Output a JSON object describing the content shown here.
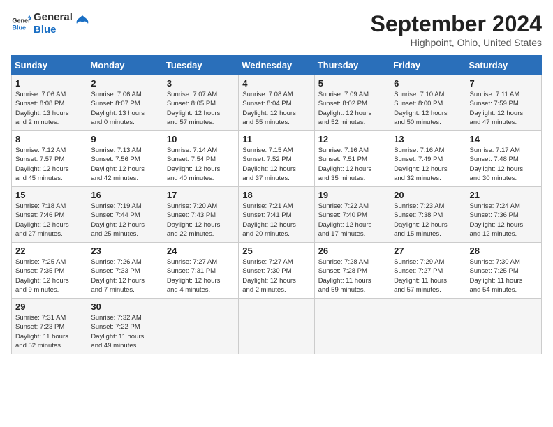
{
  "logo": {
    "line1": "General",
    "line2": "Blue"
  },
  "title": "September 2024",
  "subtitle": "Highpoint, Ohio, United States",
  "days_of_week": [
    "Sunday",
    "Monday",
    "Tuesday",
    "Wednesday",
    "Thursday",
    "Friday",
    "Saturday"
  ],
  "weeks": [
    [
      {
        "day": "1",
        "sunrise": "7:06 AM",
        "sunset": "8:08 PM",
        "daylight": "13 hours and 2 minutes."
      },
      {
        "day": "2",
        "sunrise": "7:06 AM",
        "sunset": "8:07 PM",
        "daylight": "13 hours and 0 minutes."
      },
      {
        "day": "3",
        "sunrise": "7:07 AM",
        "sunset": "8:05 PM",
        "daylight": "12 hours and 57 minutes."
      },
      {
        "day": "4",
        "sunrise": "7:08 AM",
        "sunset": "8:04 PM",
        "daylight": "12 hours and 55 minutes."
      },
      {
        "day": "5",
        "sunrise": "7:09 AM",
        "sunset": "8:02 PM",
        "daylight": "12 hours and 52 minutes."
      },
      {
        "day": "6",
        "sunrise": "7:10 AM",
        "sunset": "8:00 PM",
        "daylight": "12 hours and 50 minutes."
      },
      {
        "day": "7",
        "sunrise": "7:11 AM",
        "sunset": "7:59 PM",
        "daylight": "12 hours and 47 minutes."
      }
    ],
    [
      {
        "day": "8",
        "sunrise": "7:12 AM",
        "sunset": "7:57 PM",
        "daylight": "12 hours and 45 minutes."
      },
      {
        "day": "9",
        "sunrise": "7:13 AM",
        "sunset": "7:56 PM",
        "daylight": "12 hours and 42 minutes."
      },
      {
        "day": "10",
        "sunrise": "7:14 AM",
        "sunset": "7:54 PM",
        "daylight": "12 hours and 40 minutes."
      },
      {
        "day": "11",
        "sunrise": "7:15 AM",
        "sunset": "7:52 PM",
        "daylight": "12 hours and 37 minutes."
      },
      {
        "day": "12",
        "sunrise": "7:16 AM",
        "sunset": "7:51 PM",
        "daylight": "12 hours and 35 minutes."
      },
      {
        "day": "13",
        "sunrise": "7:16 AM",
        "sunset": "7:49 PM",
        "daylight": "12 hours and 32 minutes."
      },
      {
        "day": "14",
        "sunrise": "7:17 AM",
        "sunset": "7:48 PM",
        "daylight": "12 hours and 30 minutes."
      }
    ],
    [
      {
        "day": "15",
        "sunrise": "7:18 AM",
        "sunset": "7:46 PM",
        "daylight": "12 hours and 27 minutes."
      },
      {
        "day": "16",
        "sunrise": "7:19 AM",
        "sunset": "7:44 PM",
        "daylight": "12 hours and 25 minutes."
      },
      {
        "day": "17",
        "sunrise": "7:20 AM",
        "sunset": "7:43 PM",
        "daylight": "12 hours and 22 minutes."
      },
      {
        "day": "18",
        "sunrise": "7:21 AM",
        "sunset": "7:41 PM",
        "daylight": "12 hours and 20 minutes."
      },
      {
        "day": "19",
        "sunrise": "7:22 AM",
        "sunset": "7:40 PM",
        "daylight": "12 hours and 17 minutes."
      },
      {
        "day": "20",
        "sunrise": "7:23 AM",
        "sunset": "7:38 PM",
        "daylight": "12 hours and 15 minutes."
      },
      {
        "day": "21",
        "sunrise": "7:24 AM",
        "sunset": "7:36 PM",
        "daylight": "12 hours and 12 minutes."
      }
    ],
    [
      {
        "day": "22",
        "sunrise": "7:25 AM",
        "sunset": "7:35 PM",
        "daylight": "12 hours and 9 minutes."
      },
      {
        "day": "23",
        "sunrise": "7:26 AM",
        "sunset": "7:33 PM",
        "daylight": "12 hours and 7 minutes."
      },
      {
        "day": "24",
        "sunrise": "7:27 AM",
        "sunset": "7:31 PM",
        "daylight": "12 hours and 4 minutes."
      },
      {
        "day": "25",
        "sunrise": "7:27 AM",
        "sunset": "7:30 PM",
        "daylight": "12 hours and 2 minutes."
      },
      {
        "day": "26",
        "sunrise": "7:28 AM",
        "sunset": "7:28 PM",
        "daylight": "11 hours and 59 minutes."
      },
      {
        "day": "27",
        "sunrise": "7:29 AM",
        "sunset": "7:27 PM",
        "daylight": "11 hours and 57 minutes."
      },
      {
        "day": "28",
        "sunrise": "7:30 AM",
        "sunset": "7:25 PM",
        "daylight": "11 hours and 54 minutes."
      }
    ],
    [
      {
        "day": "29",
        "sunrise": "7:31 AM",
        "sunset": "7:23 PM",
        "daylight": "11 hours and 52 minutes."
      },
      {
        "day": "30",
        "sunrise": "7:32 AM",
        "sunset": "7:22 PM",
        "daylight": "11 hours and 49 minutes."
      },
      null,
      null,
      null,
      null,
      null
    ]
  ],
  "labels": {
    "sunrise": "Sunrise:",
    "sunset": "Sunset:",
    "daylight": "Daylight hours"
  }
}
